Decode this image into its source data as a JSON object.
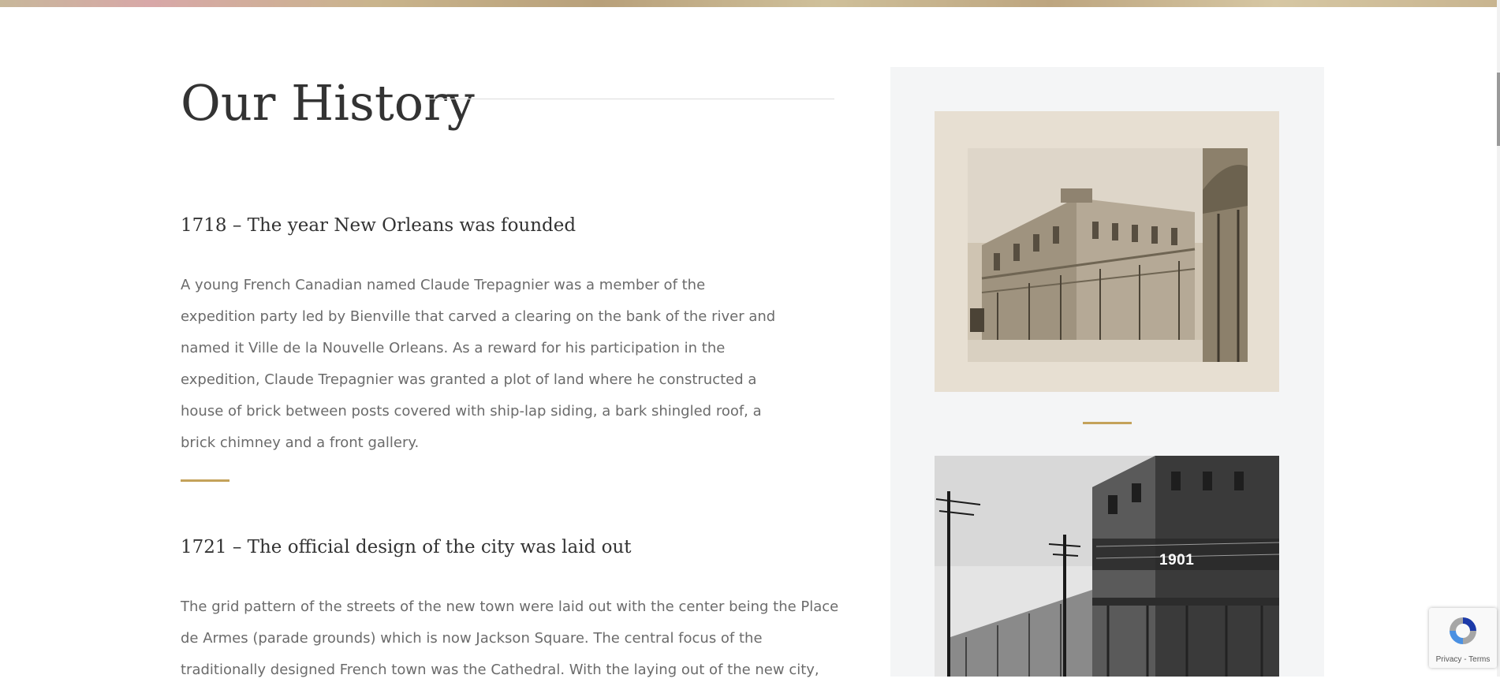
{
  "history": {
    "title": "Our History",
    "entries": [
      {
        "heading": "1718 – The year New Orleans was founded",
        "lines": [
          "A young French Canadian named Claude Trepagnier was a member of the",
          "expedition party led by Bienville that carved a clearing on the bank of the river and",
          "named it Ville de la Nouvelle Orleans. As a reward for his participation in the",
          "expedition, Claude Trepagnier was granted a plot of land where he constructed a",
          "house of brick between posts covered with ship-lap siding, a bark shingled roof, a",
          "brick chimney and a front gallery."
        ]
      },
      {
        "heading": "1721 – The official design of the city was laid out",
        "lines": [
          "The grid pattern of the streets of the new town were laid out with the center being the Place",
          "de Armes (parade grounds) which is now Jackson Square. The central focus of the",
          "traditionally designed French town was the Cathedral. With the laying out of the new city,"
        ]
      }
    ]
  },
  "sidebar": {
    "photo2_caption": "1901"
  },
  "recaptcha": {
    "privacy": "Privacy",
    "separator": " - ",
    "terms": "Terms"
  },
  "colors": {
    "accent_gold": "#c4a25a",
    "heading_text": "#333333",
    "body_text": "#6b6b6b",
    "sidebar_bg": "#f4f5f6"
  }
}
